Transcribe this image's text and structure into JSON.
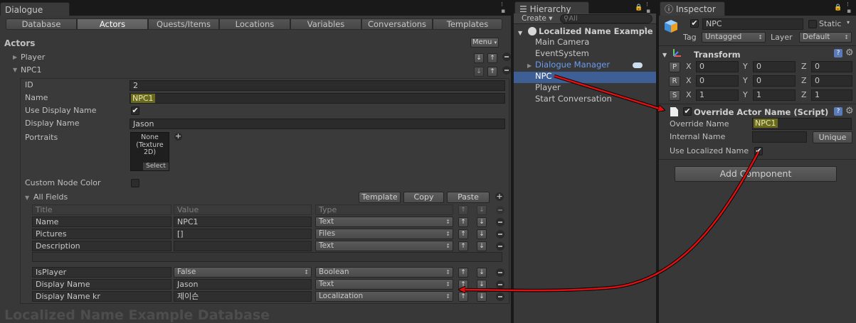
{
  "dialogue": {
    "tab_title": "Dialogue",
    "toolbar_tabs": [
      "Database",
      "Actors",
      "Quests/Items",
      "Locations",
      "Variables",
      "Conversations",
      "Templates"
    ],
    "selected_tab": "Actors",
    "section_title": "Actors",
    "menu_button": "Menu",
    "actors": [
      "Player",
      "NPC1"
    ],
    "expanded_actor": "NPC1",
    "fields": {
      "id_label": "ID",
      "id_value": "2",
      "name_label": "Name",
      "name_value": "NPC1",
      "use_display_name_label": "Use Display Name",
      "use_display_name_checked": true,
      "display_name_label": "Display Name",
      "display_name_value": "Jason",
      "portraits_label": "Portraits",
      "portrait_slot_text": [
        "None",
        "(Texture",
        "2D)"
      ],
      "portrait_select": "Select",
      "custom_node_color_label": "Custom Node Color",
      "custom_node_color_checked": false
    },
    "all_fields": {
      "label": "All Fields",
      "buttons": [
        "Template",
        "Copy",
        "Paste"
      ],
      "columns": [
        "Title",
        "Value",
        "Type"
      ],
      "rows": [
        {
          "title": "Name",
          "value": "NPC1",
          "type": "Text",
          "value_is_dropdown": false
        },
        {
          "title": "Pictures",
          "value": "[]",
          "type": "Files",
          "value_is_dropdown": false
        },
        {
          "title": "Description",
          "value": "",
          "type": "Text",
          "value_is_dropdown": false
        },
        {
          "title": "IsPlayer",
          "value": "False",
          "type": "Boolean",
          "value_is_dropdown": true
        },
        {
          "title": "Display Name",
          "value": "Jason",
          "type": "Text",
          "value_is_dropdown": false
        },
        {
          "title": "Display Name kr",
          "value": "제이슨",
          "type": "Localization",
          "value_is_dropdown": false
        }
      ]
    },
    "database_watermark": "Localized Name Example Database"
  },
  "hierarchy": {
    "tab_title": "Hierarchy",
    "create_button": "Create",
    "search_placeholder": "All",
    "scene_name": "Localized Name Example",
    "items": [
      {
        "label": "Main Camera",
        "selected": false,
        "prefab": false
      },
      {
        "label": "EventSystem",
        "selected": false,
        "prefab": false
      },
      {
        "label": "Dialogue Manager",
        "selected": false,
        "prefab": true
      },
      {
        "label": "NPC",
        "selected": true,
        "prefab": false
      },
      {
        "label": "Player",
        "selected": false,
        "prefab": false
      },
      {
        "label": "Start Conversation",
        "selected": false,
        "prefab": false
      }
    ]
  },
  "inspector": {
    "tab_title": "Inspector",
    "object_name": "NPC",
    "static_label": "Static",
    "tag_label": "Tag",
    "tag_value": "Untagged",
    "layer_label": "Layer",
    "layer_value": "Default",
    "transform": {
      "title": "Transform",
      "rows": [
        {
          "btn": "P",
          "x": "0",
          "y": "0",
          "z": "0"
        },
        {
          "btn": "R",
          "x": "0",
          "y": "0",
          "z": "0"
        },
        {
          "btn": "S",
          "x": "1",
          "y": "1",
          "z": "1"
        }
      ],
      "axis_labels": [
        "X",
        "Y",
        "Z"
      ]
    },
    "component": {
      "title": "Override Actor Name (Script)",
      "override_name_label": "Override Name",
      "override_name_value": "NPC1",
      "internal_name_label": "Internal Name",
      "internal_name_value": "",
      "unique_button": "Unique",
      "use_localized_label": "Use Localized Name",
      "use_localized_checked": true
    },
    "add_component_button": "Add Component"
  },
  "colors": {
    "panel": "#383838",
    "selection": "#3e5f96",
    "highlight": "#6b6b1f",
    "arrow": "#e01010",
    "prefab_text": "#6a9cf0"
  }
}
